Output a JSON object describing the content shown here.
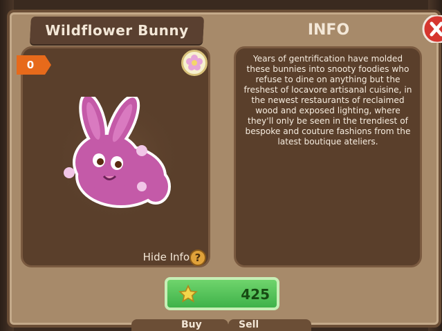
{
  "item": {
    "title": "Wildflower Bunny",
    "count": "0",
    "price": "425"
  },
  "info": {
    "heading": "INFO",
    "description": "Years of gentrification have molded these bunnies into snooty foodies who refuse to dine on anything but the freshest of locavore artisanal cuisine, in the newest restaurants of reclaimed wood and exposed lighting, where they'll only be seen in the trendiest of bespoke and couture fashions from the latest boutique ateliers."
  },
  "controls": {
    "hide_info": "Hide Info",
    "help": "?",
    "buy": "Buy",
    "sell": "Sell"
  },
  "colors": {
    "frame": "#a78a6a",
    "panel": "#5a3f2b",
    "accent_orange": "#e76a1b",
    "price_green": "#3fb24a",
    "close_red": "#d6362f"
  },
  "icons": {
    "close": "close-x-icon",
    "flower": "flower-icon",
    "star": "star-icon",
    "help": "question-mark-icon"
  }
}
